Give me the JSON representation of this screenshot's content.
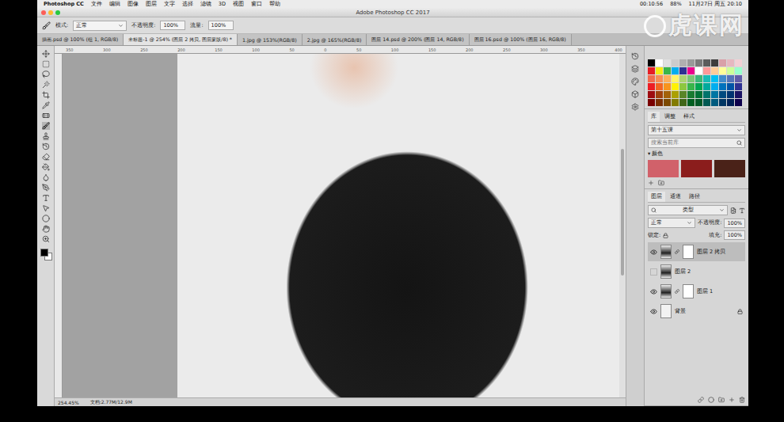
{
  "menubar": {
    "app": "Photoshop CC",
    "items": [
      "文件",
      "编辑",
      "图像",
      "图层",
      "文字",
      "选择",
      "滤镜",
      "3D",
      "视图",
      "窗口",
      "帮助"
    ],
    "status": [
      "00:10:56",
      "88%",
      "11月27日 周五 20:10"
    ]
  },
  "window": {
    "title": "Adobe Photoshop CC 2017"
  },
  "options": {
    "mode_label": "模式:",
    "mode": "正常",
    "opacity_label": "不透明度:",
    "opacity": "100%",
    "flow_label": "流量:",
    "flow": "100%"
  },
  "tabs": [
    {
      "label": "插画.psd @ 100% (组 1, RGB/8)",
      "selected": false
    },
    {
      "label": "未标题-1 @ 254% (图层 2 拷贝, 图层蒙版/8) *",
      "selected": true
    },
    {
      "label": "1.jpg @ 153%(RGB/8)",
      "selected": false
    },
    {
      "label": "2.jpg @ 165%(RGB/8)",
      "selected": false
    },
    {
      "label": "图层 14.psd @ 200% (图层 14, RGB/8)",
      "selected": false
    },
    {
      "label": "图层 16.psd @ 100% (图层 16, RGB/8)",
      "selected": false
    }
  ],
  "ruler": [
    "350",
    "300",
    "250",
    "200",
    "150",
    "100",
    "50",
    "0",
    "50",
    "100",
    "150",
    "200",
    "250",
    "300",
    "350",
    "400"
  ],
  "swatches": [
    "#000000",
    "#ffffff",
    "#e0e0e0",
    "#cccccc",
    "#b0b0b0",
    "#999999",
    "#7a7a7a",
    "#5c5c5c",
    "#3d3d3d",
    "#d9a0a8",
    "#e6b8c0",
    "#f2d0d5",
    "#e61e25",
    "#f5ea14",
    "#39b54a",
    "#00aeef",
    "#2e3192",
    "#ec008c",
    "#ffffff",
    "#ff9999",
    "#ffcc99",
    "#ffff99",
    "#ccff99",
    "#99ffcc",
    "#f26c4f",
    "#f68e55",
    "#fbaf5c",
    "#fff467",
    "#acd372",
    "#7cc576",
    "#3bb878",
    "#1abbb4",
    "#00bff3",
    "#438ccb",
    "#5574b9",
    "#605ca8",
    "#ed1c24",
    "#f26522",
    "#f7941d",
    "#fff200",
    "#8dc73f",
    "#39b54a",
    "#00a651",
    "#00a99d",
    "#00aeef",
    "#0072bc",
    "#0054a6",
    "#2e3192",
    "#9e0b0f",
    "#a0410d",
    "#a3620a",
    "#aba000",
    "#598527",
    "#197b30",
    "#007236",
    "#00746b",
    "#0076a3",
    "#004a80",
    "#003471",
    "#1b1464",
    "#790000",
    "#7b2e00",
    "#7d4900",
    "#827b00",
    "#406618",
    "#005e20",
    "#005826",
    "#005952",
    "#005b7f",
    "#003663",
    "#002157",
    "#0d004c"
  ],
  "library": {
    "tabs": [
      {
        "label": "库",
        "selected": true
      },
      {
        "label": "调整",
        "selected": false
      },
      {
        "label": "样式",
        "selected": false
      }
    ],
    "dropdown": "第十五课",
    "search": "搜索当前库",
    "section": {
      "arrow": "▾",
      "label": "颜色"
    },
    "colors": [
      "#d1616a",
      "#8b1d1c",
      "#4a2218"
    ]
  },
  "layers": {
    "tabs": [
      {
        "label": "图层",
        "selected": true
      },
      {
        "label": "通道",
        "selected": false
      },
      {
        "label": "路径",
        "selected": false
      }
    ],
    "filter": "类型",
    "blend": "正常",
    "opacity_label": "不透明度:",
    "opacity": "100%",
    "lock_label": "锁定:",
    "fill_label": "填充:",
    "fill": "100%",
    "items": [
      {
        "name": "图层 2 拷贝",
        "visible": true,
        "selected": true,
        "mask": true,
        "locked": false
      },
      {
        "name": "图层 2",
        "visible": false,
        "selected": false,
        "mask": false,
        "locked": false
      },
      {
        "name": "图层 1",
        "visible": true,
        "selected": false,
        "mask": true,
        "locked": false
      },
      {
        "name": "背景",
        "visible": true,
        "selected": false,
        "mask": false,
        "locked": true
      }
    ]
  },
  "status_bar": {
    "zoom": "254.45%",
    "doc": "文档:2.77M/12.9M"
  },
  "watermark": "虎课网"
}
